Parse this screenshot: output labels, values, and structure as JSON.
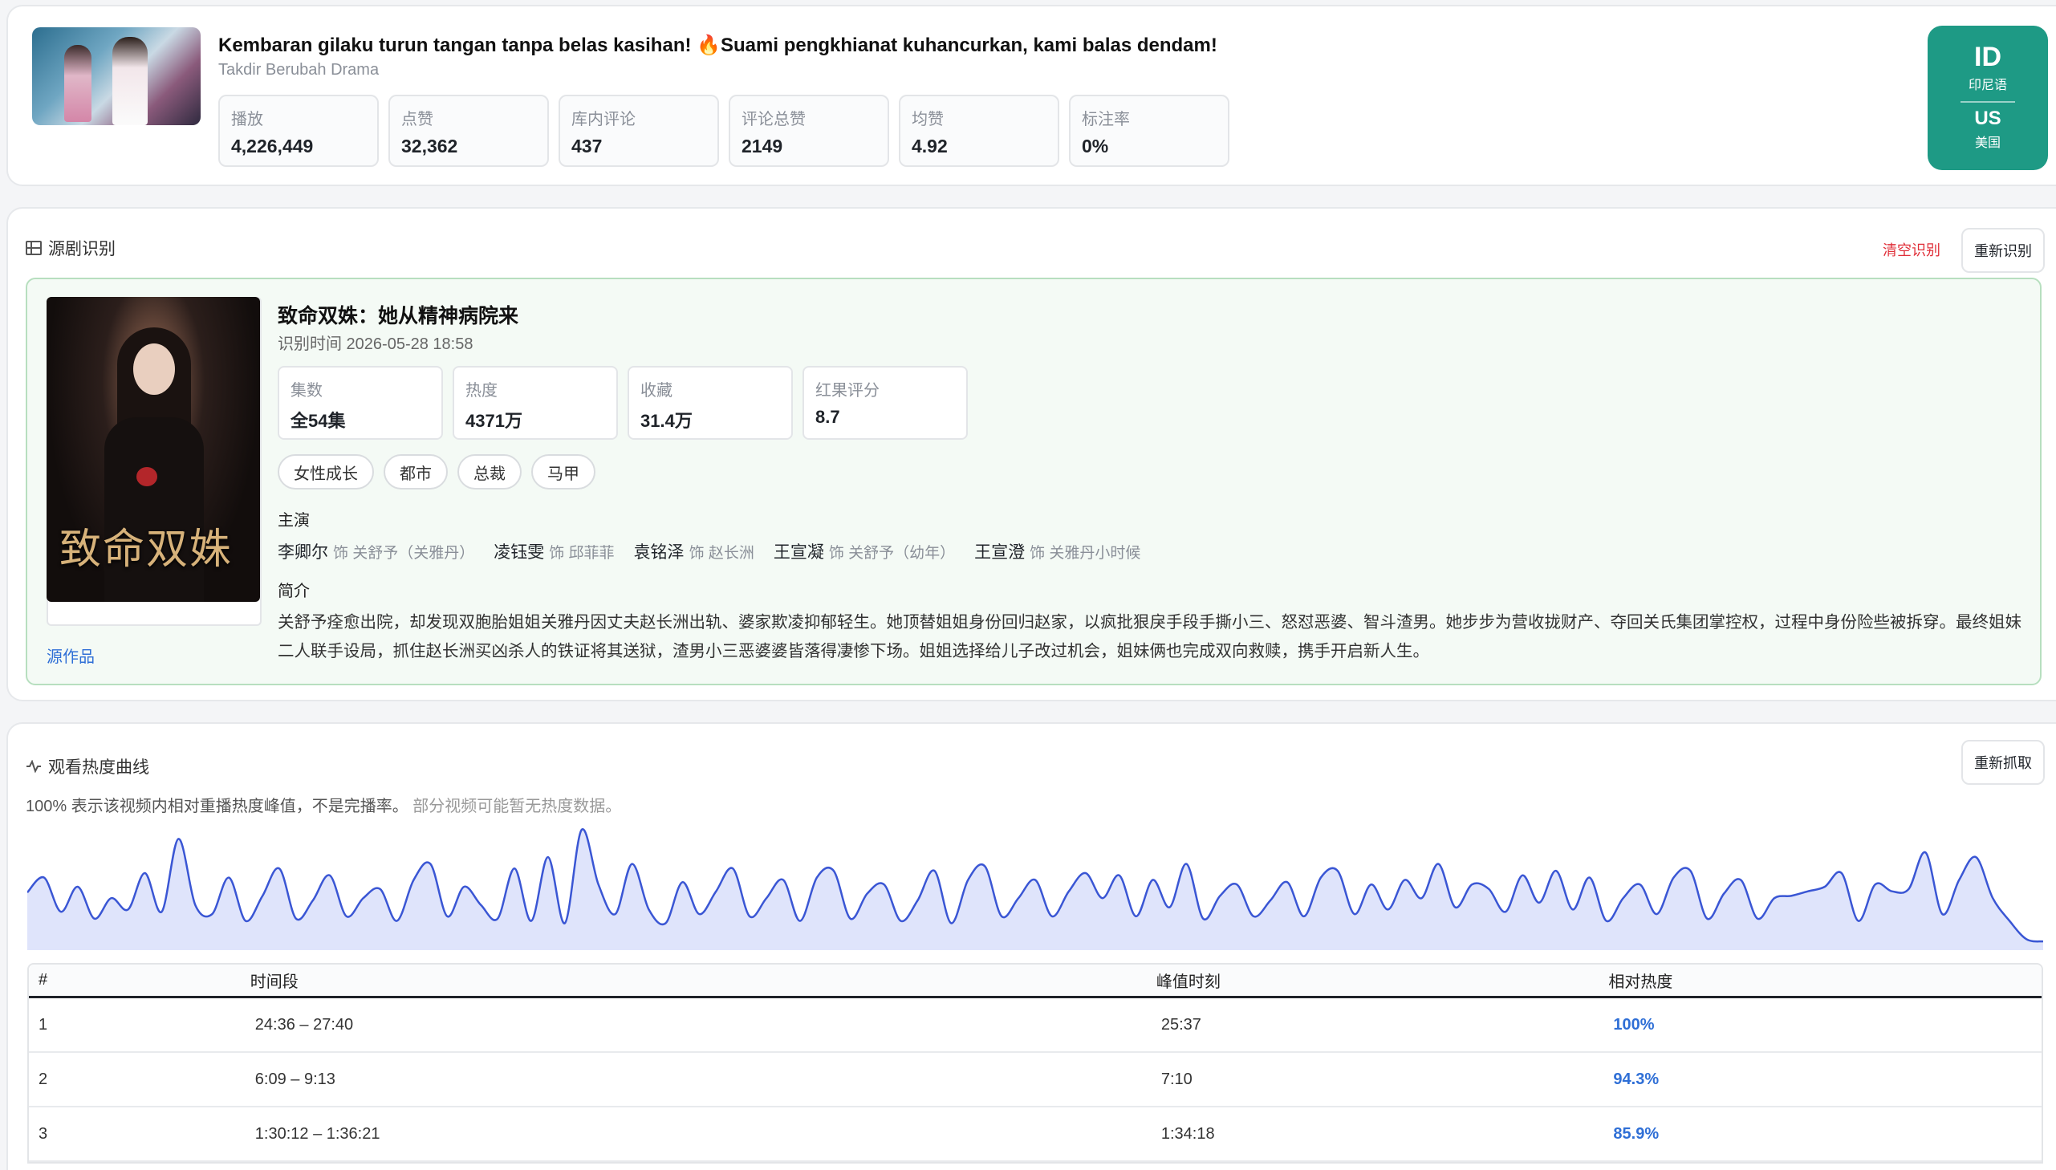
{
  "video": {
    "title": "Kembaran gilaku turun tangan tanpa belas kasihan! 🔥Suami pengkhianat kuhancurkan, kami balas dendam!",
    "subtitle": "Takdir Berubah Drama",
    "stats": [
      {
        "label": "播放",
        "value": "4,226,449"
      },
      {
        "label": "点赞",
        "value": "32,362"
      },
      {
        "label": "库内评论",
        "value": "437"
      },
      {
        "label": "评论总赞",
        "value": "2149"
      },
      {
        "label": "均赞",
        "value": "4.92"
      },
      {
        "label": "标注率",
        "value": "0%"
      }
    ],
    "region": {
      "lang_code": "ID",
      "lang_name": "印尼语",
      "country_code": "US",
      "country_name": "美国",
      "color": "#1e9a85"
    }
  },
  "source": {
    "section_title": "源剧识别",
    "clear_label": "清空识别",
    "reidentify_label": "重新识别",
    "poster_text": "致命双姝",
    "drama_title": "致命双姝：她从精神病院来",
    "identified_time": "识别时间 2026-05-28 18:58",
    "stats": [
      {
        "label": "集数",
        "value": "全54集"
      },
      {
        "label": "热度",
        "value": "4371万"
      },
      {
        "label": "收藏",
        "value": "31.4万"
      },
      {
        "label": "红果评分",
        "value": "8.7"
      }
    ],
    "tags": [
      "女性成长",
      "都市",
      "总裁",
      "马甲"
    ],
    "cast_label": "主演",
    "cast": [
      {
        "name": "李卿尔",
        "role": "饰 关舒予（关雅丹）"
      },
      {
        "name": "凌钰雯",
        "role": "饰 邱菲菲"
      },
      {
        "name": "袁铭泽",
        "role": "饰 赵长洲"
      },
      {
        "name": "王宣凝",
        "role": "饰 关舒予（幼年）"
      },
      {
        "name": "王宣澄",
        "role": "饰 关雅丹小时候"
      }
    ],
    "synopsis_label": "简介",
    "synopsis": "关舒予痊愈出院，却发现双胞胎姐姐关雅丹因丈夫赵长洲出轨、婆家欺凌抑郁轻生。她顶替姐姐身份回归赵家，以疯批狠戾手段手撕小三、怒怼恶婆、智斗渣男。她步步为营收拢财产、夺回关氏集团掌控权，过程中身份险些被拆穿。最终姐妹二人联手设局，抓住赵长洲买凶杀人的铁证将其送狱，渣男小三恶婆婆皆落得凄惨下场。姐姐选择给儿子改过机会，姐妹俩也完成双向救赎，携手开启新人生。",
    "source_link": "源作品",
    "accent": "#b7dfbf"
  },
  "heat": {
    "section_title": "观看热度曲线",
    "refetch_label": "重新抓取",
    "note_main": "100% 表示该视频内相对重播热度峰值，不是完播率。",
    "note_muted": "部分视频可能暂无热度数据。",
    "line_color": "#3a56d4",
    "fill_color": "#dfe4fb",
    "table_headers": [
      "#",
      "时间段",
      "峰值时刻",
      "相对热度"
    ],
    "rows": [
      {
        "rank": "1",
        "range": "24:36 – 27:40",
        "peak": "25:37",
        "heat": "100%"
      },
      {
        "rank": "2",
        "range": "6:09 – 9:13",
        "peak": "7:10",
        "heat": "94.3%"
      },
      {
        "rank": "3",
        "range": "1:30:12 – 1:36:21",
        "peak": "1:34:18",
        "heat": "85.9%"
      }
    ]
  },
  "chart_data": {
    "type": "area",
    "title": "",
    "xlabel": "",
    "ylabel": "",
    "ylim": [
      0,
      100
    ],
    "values": [
      45,
      58,
      28,
      50,
      22,
      40,
      30,
      62,
      28,
      92,
      34,
      26,
      58,
      20,
      42,
      66,
      22,
      38,
      60,
      24,
      40,
      48,
      20,
      56,
      70,
      24,
      50,
      34,
      22,
      66,
      20,
      76,
      18,
      100,
      52,
      26,
      70,
      30,
      18,
      54,
      26,
      46,
      66,
      24,
      40,
      56,
      20,
      58,
      64,
      22,
      44,
      52,
      20,
      38,
      64,
      18,
      56,
      68,
      24,
      40,
      56,
      24,
      46,
      62,
      40,
      60,
      24,
      56,
      32,
      70,
      22,
      42,
      52,
      24,
      38,
      54,
      24,
      58,
      64,
      26,
      52,
      30,
      56,
      40,
      70,
      32,
      52,
      48,
      28,
      60,
      36,
      64,
      30,
      58,
      20,
      40,
      52,
      26,
      58,
      64,
      22,
      44,
      56,
      22,
      40,
      42,
      46,
      50,
      62,
      20,
      52,
      46,
      48,
      80,
      26,
      56,
      76,
      40,
      20,
      4,
      2
    ]
  }
}
